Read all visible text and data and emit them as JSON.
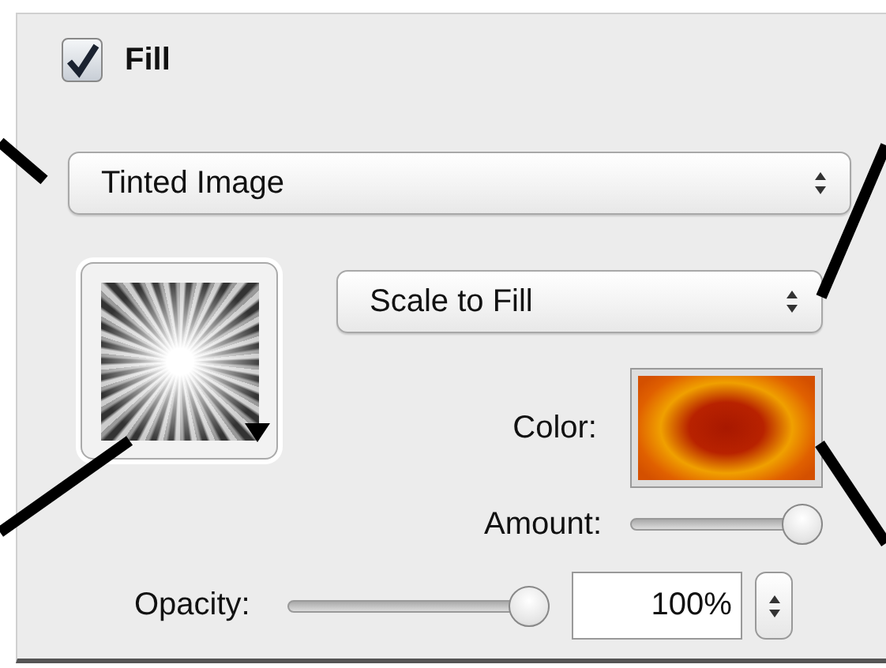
{
  "fill": {
    "label": "Fill",
    "checked": true
  },
  "fill_type": {
    "value": "Tinted Image"
  },
  "scale_mode": {
    "value": "Scale to Fill"
  },
  "color": {
    "label": "Color:"
  },
  "amount": {
    "label": "Amount:",
    "level": 1
  },
  "opacity": {
    "label": "Opacity:",
    "level": 1,
    "value": "100%"
  }
}
